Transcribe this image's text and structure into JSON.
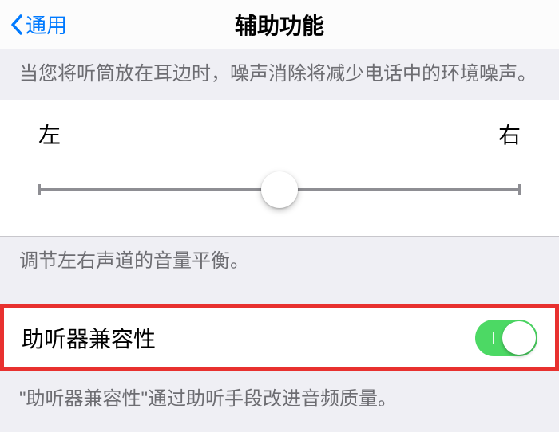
{
  "nav": {
    "back_label": "通用",
    "title": "辅助功能"
  },
  "noise_cancel_desc": "当您将听筒放在耳边时，噪声消除将减少电话中的环境噪声。",
  "balance": {
    "left_label": "左",
    "right_label": "右",
    "description": "调节左右声道的音量平衡。"
  },
  "hearing_aid": {
    "label": "助听器兼容性",
    "enabled": true,
    "description": "\"助听器兼容性\"通过助听手段改进音频质量。"
  },
  "colors": {
    "accent": "#007aff",
    "toggle_on": "#4cd964",
    "highlight_border": "#e8312f"
  }
}
